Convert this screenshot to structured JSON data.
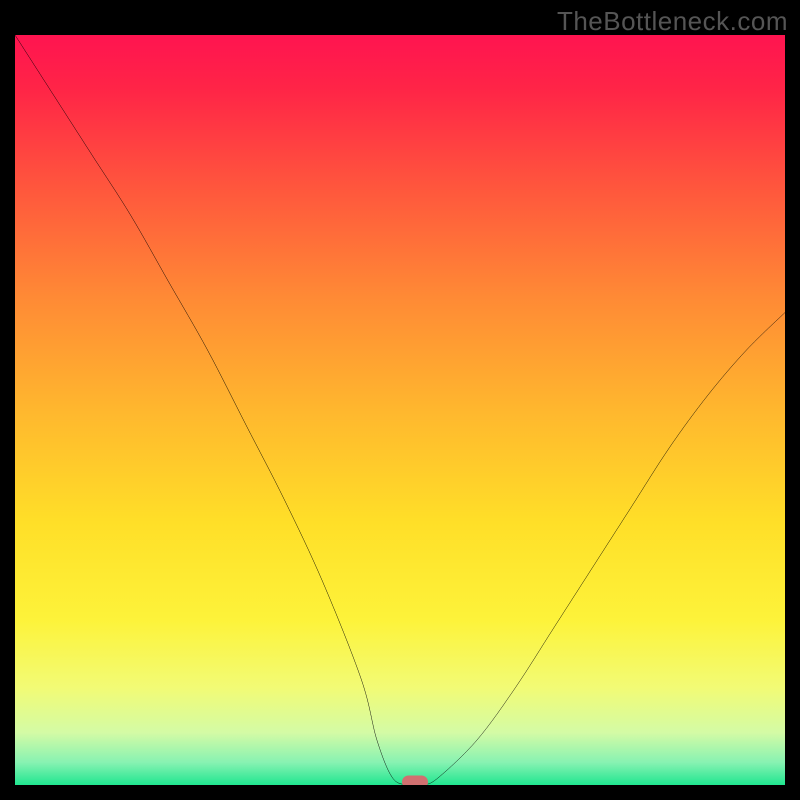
{
  "watermark": "TheBottleneck.com",
  "chart_data": {
    "type": "line",
    "title": "",
    "xlabel": "",
    "ylabel": "",
    "x_range": [
      0,
      100
    ],
    "y_range": [
      0,
      100
    ],
    "legend": false,
    "grid": false,
    "series": [
      {
        "name": "curve",
        "x": [
          0,
          5,
          10,
          15,
          20,
          25,
          30,
          35,
          40,
          45,
          47,
          49,
          51,
          53,
          55,
          60,
          65,
          70,
          75,
          80,
          85,
          90,
          95,
          100
        ],
        "y": [
          100,
          92,
          84,
          76,
          67,
          58,
          48,
          38,
          27,
          14,
          6,
          1,
          0,
          0,
          1,
          6,
          13,
          21,
          29,
          37,
          45,
          52,
          58,
          63
        ]
      }
    ],
    "min_marker": {
      "x": 52,
      "y": 0
    },
    "background_gradient": {
      "stops": [
        {
          "offset": 0.0,
          "color": "#ff1450"
        },
        {
          "offset": 0.07,
          "color": "#ff2447"
        },
        {
          "offset": 0.2,
          "color": "#ff553d"
        },
        {
          "offset": 0.35,
          "color": "#ff8a35"
        },
        {
          "offset": 0.5,
          "color": "#ffb72e"
        },
        {
          "offset": 0.65,
          "color": "#ffdf28"
        },
        {
          "offset": 0.78,
          "color": "#fdf33a"
        },
        {
          "offset": 0.87,
          "color": "#f2fb75"
        },
        {
          "offset": 0.93,
          "color": "#d4fba5"
        },
        {
          "offset": 0.97,
          "color": "#87f2b2"
        },
        {
          "offset": 1.0,
          "color": "#20e690"
        }
      ]
    }
  }
}
